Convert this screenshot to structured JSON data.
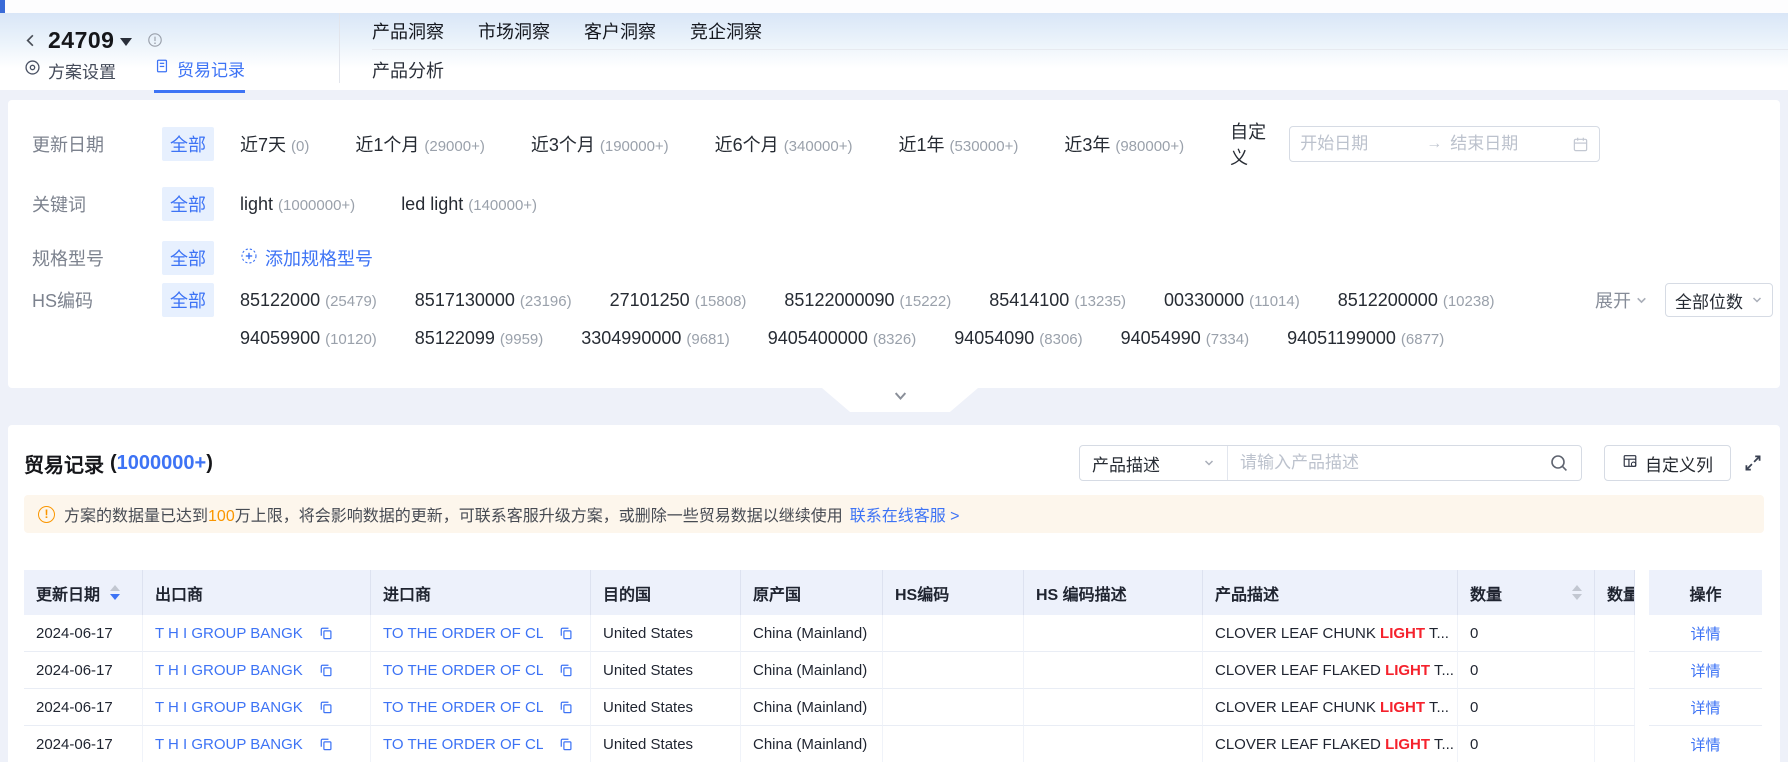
{
  "colors": {
    "accent": "#3d73f5",
    "warning": "#fa9600",
    "keyword_highlight": "#f5222d"
  },
  "icons": {
    "back-icon": "‹",
    "title-caret-icon": "▼",
    "info-icon": "ⓘ",
    "plan-settings-icon": "◎",
    "trade-records-icon": "🗒",
    "add-icon": "+",
    "range-arrow-icon": "→",
    "calendar-icon": "📅",
    "chevron-down-icon": "∨",
    "search-icon": "🔍",
    "customize-columns-icon": "▦",
    "fullscreen-icon": "⤢",
    "copy-icon": "⧉",
    "sort-caret-up": "▲",
    "sort-caret-down": "▼",
    "exclamation": "!"
  },
  "header": {
    "title": "24709",
    "tabs": {
      "settings": "方案设置",
      "records": "贸易记录"
    },
    "nav": {
      "items": [
        "产品洞察",
        "市场洞察",
        "客户洞察",
        "竞企洞察"
      ],
      "sub": "产品分析"
    }
  },
  "filters": {
    "update_date": {
      "label": "更新日期",
      "all": "全部",
      "options": [
        {
          "text": "近7天",
          "count": "(0)"
        },
        {
          "text": "近1个月",
          "count": "(29000+)"
        },
        {
          "text": "近3个月",
          "count": "(190000+)"
        },
        {
          "text": "近6个月",
          "count": "(340000+)"
        },
        {
          "text": "近1年",
          "count": "(530000+)"
        },
        {
          "text": "近3年",
          "count": "(980000+)"
        }
      ],
      "custom": "自定义",
      "start_placeholder": "开始日期",
      "end_placeholder": "结束日期"
    },
    "keyword": {
      "label": "关键词",
      "all": "全部",
      "options": [
        {
          "text": "light",
          "count": "(1000000+)"
        },
        {
          "text": "led light",
          "count": "(140000+)"
        }
      ]
    },
    "spec": {
      "label": "规格型号",
      "all": "全部",
      "add": "添加规格型号"
    },
    "hs_code": {
      "label": "HS编码",
      "all": "全部",
      "line1": [
        {
          "text": "85122000",
          "count": "(25479)"
        },
        {
          "text": "8517130000",
          "count": "(23196)"
        },
        {
          "text": "27101250",
          "count": "(15808)"
        },
        {
          "text": "85122000090",
          "count": "(15222)"
        },
        {
          "text": "85414100",
          "count": "(13235)"
        },
        {
          "text": "00330000",
          "count": "(11014)"
        },
        {
          "text": "8512200000",
          "count": "(10238)"
        }
      ],
      "line2": [
        {
          "text": "94059900",
          "count": "(10120)"
        },
        {
          "text": "85122099",
          "count": "(9959)"
        },
        {
          "text": "3304990000",
          "count": "(9681)"
        },
        {
          "text": "9405400000",
          "count": "(8326)"
        },
        {
          "text": "94054090",
          "count": "(8306)"
        },
        {
          "text": "94054990",
          "count": "(7334)"
        },
        {
          "text": "94051199000",
          "count": "(6877)"
        }
      ],
      "expand": "展开",
      "digits": "全部位数"
    }
  },
  "trade": {
    "title": "贸易记录",
    "count_open": "(",
    "count": "1000000+",
    "count_close": ")",
    "search": {
      "field": "产品描述",
      "placeholder": "请输入产品描述"
    },
    "customize": "自定义列",
    "banner": {
      "text_before": "方案的数据量已达到",
      "highlight": "100",
      "text_after": "万上限，将会影响数据的更新，可联系客服升级方案，或删除一些贸易数据以继续使用",
      "link": "联系在线客服 >"
    },
    "table": {
      "columns": {
        "date": "更新日期",
        "exporter": "出口商",
        "importer": "进口商",
        "destination": "目的国",
        "origin": "原产国",
        "hs_code": "HS编码",
        "hs_desc": "HS 编码描述",
        "product": "产品描述",
        "quantity": "数量",
        "unit": "数量单位",
        "action": "操作"
      },
      "rows": [
        {
          "date": "2024-06-17",
          "exporter": "T H I GROUP BANGK",
          "importer": "TO THE ORDER OF CL",
          "destination": "United States",
          "origin": "China (Mainland)",
          "hs_code": "",
          "hs_desc": "",
          "product_before": "CLOVER LEAF CHUNK ",
          "product_highlight": "LIGHT",
          "product_after": " T...",
          "quantity": "0",
          "unit": "",
          "action": "详情"
        },
        {
          "date": "2024-06-17",
          "exporter": "T H I GROUP BANGK",
          "importer": "TO THE ORDER OF CL",
          "destination": "United States",
          "origin": "China (Mainland)",
          "hs_code": "",
          "hs_desc": "",
          "product_before": "CLOVER LEAF FLAKED ",
          "product_highlight": "LIGHT",
          "product_after": " T...",
          "quantity": "0",
          "unit": "",
          "action": "详情"
        },
        {
          "date": "2024-06-17",
          "exporter": "T H I GROUP BANGK",
          "importer": "TO THE ORDER OF CL",
          "destination": "United States",
          "origin": "China (Mainland)",
          "hs_code": "",
          "hs_desc": "",
          "product_before": "CLOVER LEAF CHUNK ",
          "product_highlight": "LIGHT",
          "product_after": " T...",
          "quantity": "0",
          "unit": "",
          "action": "详情"
        },
        {
          "date": "2024-06-17",
          "exporter": "T H I GROUP BANGK",
          "importer": "TO THE ORDER OF CL",
          "destination": "United States",
          "origin": "China (Mainland)",
          "hs_code": "",
          "hs_desc": "",
          "product_before": "CLOVER LEAF FLAKED ",
          "product_highlight": "LIGHT",
          "product_after": " T...",
          "quantity": "0",
          "unit": "",
          "action": "详情"
        }
      ]
    }
  }
}
